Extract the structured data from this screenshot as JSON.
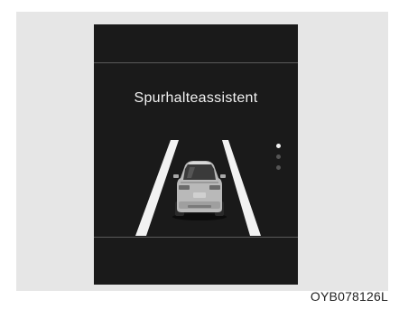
{
  "display": {
    "title": "Spurhalteassistent",
    "indicator": {
      "total": 3,
      "active_index": 0
    }
  },
  "figure": {
    "code": "OYB078126L"
  },
  "colors": {
    "screen": "#1a1a1a",
    "lane": "#f2f2f2",
    "panel": "#e6e6e6",
    "dot_active": "#f2f2f2",
    "dot_inactive": "#555555"
  },
  "icons": [
    "car-rear-icon",
    "lane-line-left-icon",
    "lane-line-right-icon",
    "page-indicator-icon"
  ]
}
